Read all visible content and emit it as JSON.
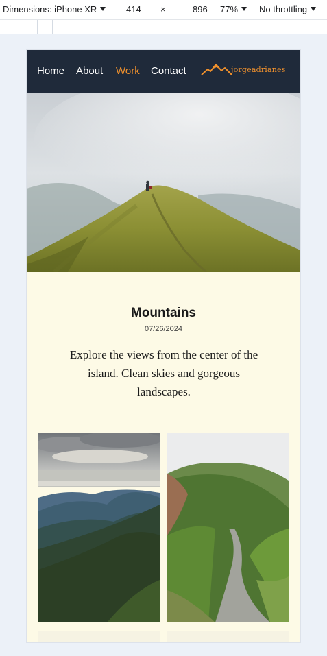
{
  "devtools": {
    "device_label": "Dimensions: iPhone XR",
    "width": "414",
    "times": "×",
    "height": "896",
    "zoom": "77%",
    "throttling": "No throttling"
  },
  "nav": {
    "items": [
      {
        "label": "Home"
      },
      {
        "label": "About"
      },
      {
        "label": "Work"
      },
      {
        "label": "Contact"
      }
    ],
    "active": "Work",
    "logo_text": "jorgeadrianes"
  },
  "post": {
    "title": "Mountains",
    "date": "07/26/2024",
    "description": "Explore the views from the center of the island. Clean skies and gorgeous landscapes."
  },
  "colors": {
    "nav_bg": "#1f2a3a",
    "accent": "#f0912d",
    "content_bg": "#fdfae6"
  }
}
